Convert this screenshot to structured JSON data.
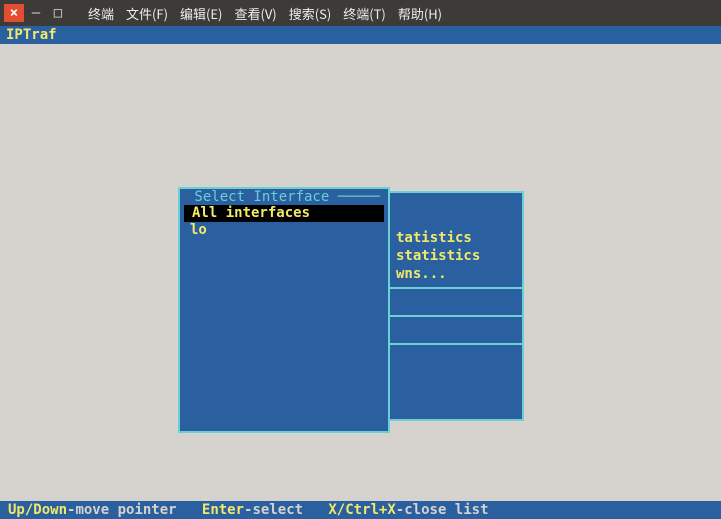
{
  "window": {
    "close_icon": "×",
    "min_icon": "—",
    "max_icon": "□",
    "menu": [
      "终端",
      "文件(F)",
      "编辑(E)",
      "查看(V)",
      "搜索(S)",
      "终端(T)",
      "帮助(H)"
    ]
  },
  "app": {
    "title": "IPTraf"
  },
  "dialog": {
    "title": " Select Interface ─────",
    "items": [
      "All interfaces",
      "lo"
    ],
    "selected_index": 0
  },
  "background_menu": {
    "lines": [
      "tatistics",
      "statistics",
      "wns..."
    ]
  },
  "footer": {
    "k1": "Up/Down",
    "d1": "-move pointer",
    "k2": "Enter",
    "d2": "-select",
    "k3": "X/Ctrl+X",
    "d3": "-close list"
  }
}
